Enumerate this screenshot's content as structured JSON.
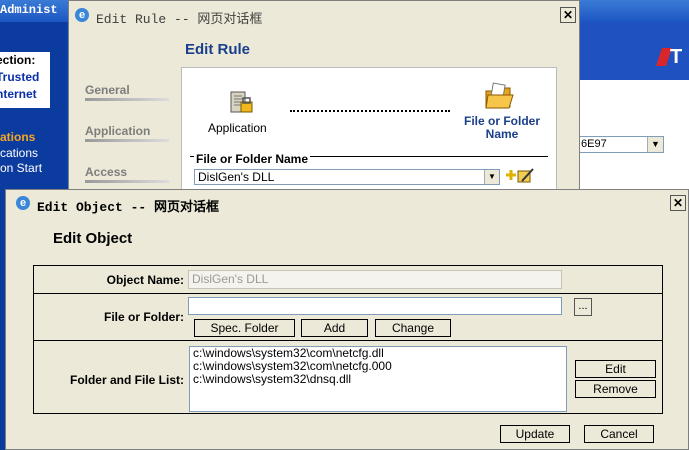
{
  "background": {
    "title_fragment": "Administ",
    "left_white_lines": [
      "ection:",
      "Trusted",
      "nternet"
    ],
    "section_header": "ations",
    "links": [
      "cations",
      "on Start"
    ],
    "right_select_value": "6E97",
    "logo_text": "T"
  },
  "edit_rule_dialog": {
    "title": "Edit Rule -- 网页对话框",
    "heading": "Edit Rule",
    "tabs": [
      "General",
      "Application",
      "Access"
    ],
    "application_label": "Application",
    "file_folder_label": "File or Folder Name",
    "fieldset_legend": "File or Folder Name",
    "selected_object": "DislGen's DLL"
  },
  "edit_object_dialog": {
    "title": "Edit Object -- 网页对话框",
    "heading": "Edit Object",
    "object_name_label": "Object Name:",
    "object_name_value": "DislGen's DLL",
    "file_or_folder_label": "File or Folder:",
    "file_or_folder_value": "",
    "browse_label": "...",
    "spec_folder_label": "Spec. Folder",
    "add_label": "Add",
    "change_label": "Change",
    "list_label": "Folder and File List:",
    "files": [
      "c:\\windows\\system32\\com\\netcfg.dll",
      "c:\\windows\\system32\\com\\netcfg.000",
      "c:\\windows\\system32\\dnsq.dll"
    ],
    "edit_label": "Edit",
    "remove_label": "Remove",
    "update_label": "Update",
    "cancel_label": "Cancel"
  }
}
